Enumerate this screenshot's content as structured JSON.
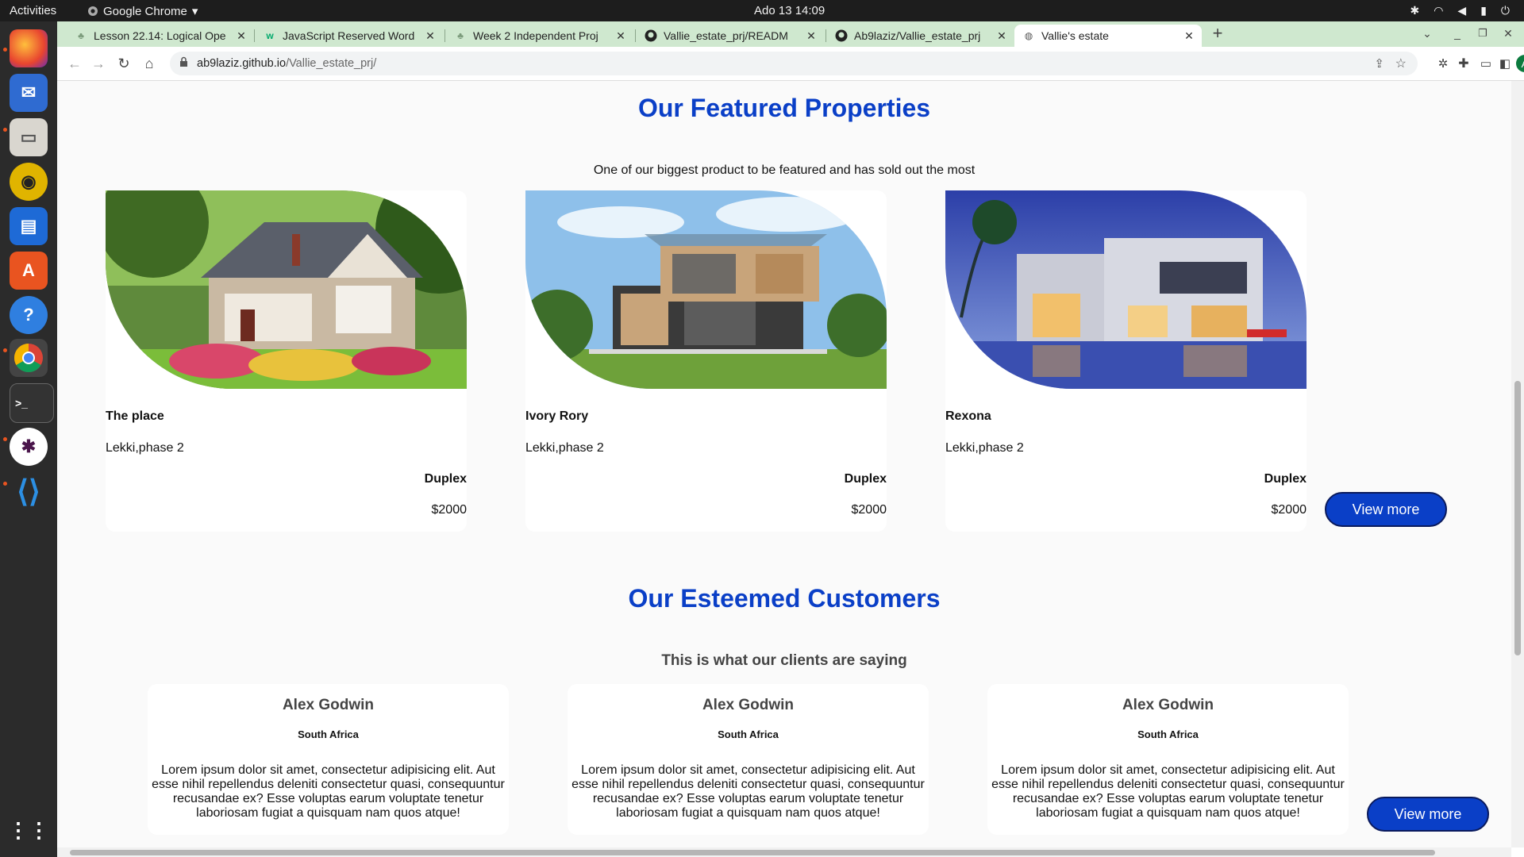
{
  "system": {
    "activities": "Activities",
    "app_name": "Google Chrome",
    "clock": "Ado 13  14:09"
  },
  "browser": {
    "tabs": [
      {
        "label": "Lesson 22.14: Logical Ope",
        "icon": "sprout-icon"
      },
      {
        "label": "JavaScript Reserved Word",
        "icon": "w3-icon"
      },
      {
        "label": "Week 2 Independent Proj",
        "icon": "sprout-icon"
      },
      {
        "label": "Vallie_estate_prj/READM",
        "icon": "github-icon"
      },
      {
        "label": "Ab9laziz/Vallie_estate_prj",
        "icon": "github-icon"
      },
      {
        "label": "Vallie's estate",
        "icon": "globe-icon"
      }
    ],
    "url_host": "ab9laziz.github.io",
    "url_path": "/Vallie_estate_prj/",
    "profile_initial": "A"
  },
  "featured": {
    "title": "Our Featured Properties",
    "subtitle": "One of our biggest product to be featured and has sold out the most",
    "properties": [
      {
        "name": "The place",
        "location": "Lekki,phase 2",
        "type": "Duplex",
        "price": "$2000"
      },
      {
        "name": "Ivory Rory",
        "location": "Lekki,phase 2",
        "type": "Duplex",
        "price": "$2000"
      },
      {
        "name": "Rexona",
        "location": "Lekki,phase 2",
        "type": "Duplex",
        "price": "$2000"
      }
    ],
    "view_more": "View more"
  },
  "customers": {
    "title": "Our Esteemed Customers",
    "subtitle": "This is what our clients are saying",
    "items": [
      {
        "name": "Alex Godwin",
        "country": "South Africa",
        "text": "Lorem ipsum dolor sit amet, consectetur adipisicing elit. Aut esse nihil repellendus deleniti consectetur quasi, consequuntur recusandae ex? Esse voluptas earum voluptate tenetur laboriosam fugiat a quisquam nam quos atque!"
      },
      {
        "name": "Alex Godwin",
        "country": "South Africa",
        "text": "Lorem ipsum dolor sit amet, consectetur adipisicing elit. Aut esse nihil repellendus deleniti consectetur quasi, consequuntur recusandae ex? Esse voluptas earum voluptate tenetur laboriosam fugiat a quisquam nam quos atque!"
      },
      {
        "name": "Alex Godwin",
        "country": "South Africa",
        "text": "Lorem ipsum dolor sit amet, consectetur adipisicing elit. Aut esse nihil repellendus deleniti consectetur quasi, consequuntur recusandae ex? Esse voluptas earum voluptate tenetur laboriosam fugiat a quisquam nam quos atque!"
      }
    ],
    "view_more": "View more"
  },
  "colors": {
    "accent": "#0a3fc7",
    "tab_strip": "#cfe8cf"
  }
}
